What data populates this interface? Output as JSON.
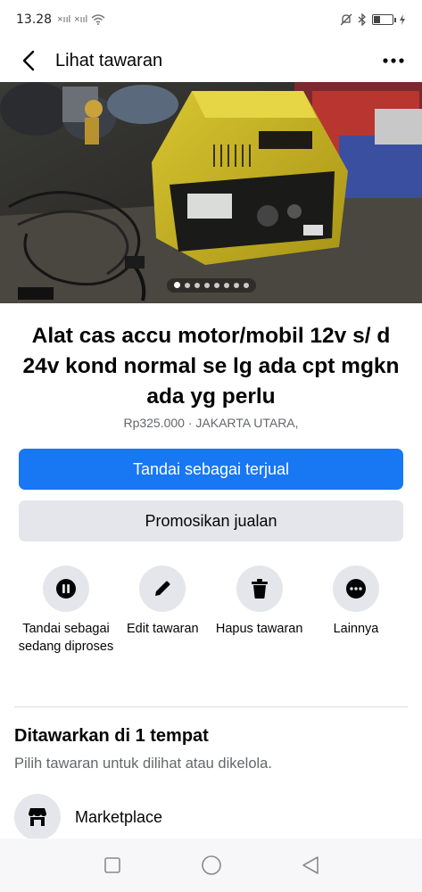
{
  "status_bar": {
    "time": "13.28",
    "signal_1": "×ııl",
    "signal_2": "×ııl",
    "wifi_icon": "wifi-icon",
    "silent_icon": "silent-icon",
    "bluetooth_icon": "bluetooth-icon",
    "battery_icon": "battery-icon"
  },
  "header": {
    "title": "Lihat tawaran",
    "back_icon": "back-arrow-icon",
    "more_icon": "more-dots-icon"
  },
  "photo": {
    "total_images": 8,
    "active_index": 0
  },
  "listing": {
    "title": "Alat cas accu motor/mobil 12v s/ d 24v kond normal se lg ada cpt mgkn ada yg perlu",
    "meta": "Rp325.000 · JAKARTA UTARA,"
  },
  "buttons": {
    "mark_sold": "Tandai sebagai terjual",
    "promote": "Promosikan jualan"
  },
  "actions": [
    {
      "label": "Tandai sebagai sedang diproses",
      "icon": "pause-icon"
    },
    {
      "label": "Edit tawaran",
      "icon": "pencil-icon"
    },
    {
      "label": "Hapus tawaran",
      "icon": "trash-icon"
    },
    {
      "label": "Lainnya",
      "icon": "more-dots-icon"
    }
  ],
  "offered": {
    "title": "Ditawarkan di 1 tempat",
    "subtitle": "Pilih tawaran untuk dilihat atau dikelola.",
    "places": [
      {
        "label": "Marketplace",
        "icon": "shop-icon"
      }
    ]
  },
  "colors": {
    "primary": "#1877f2",
    "secondary_bg": "#e4e6eb",
    "muted_text": "#65676b"
  }
}
